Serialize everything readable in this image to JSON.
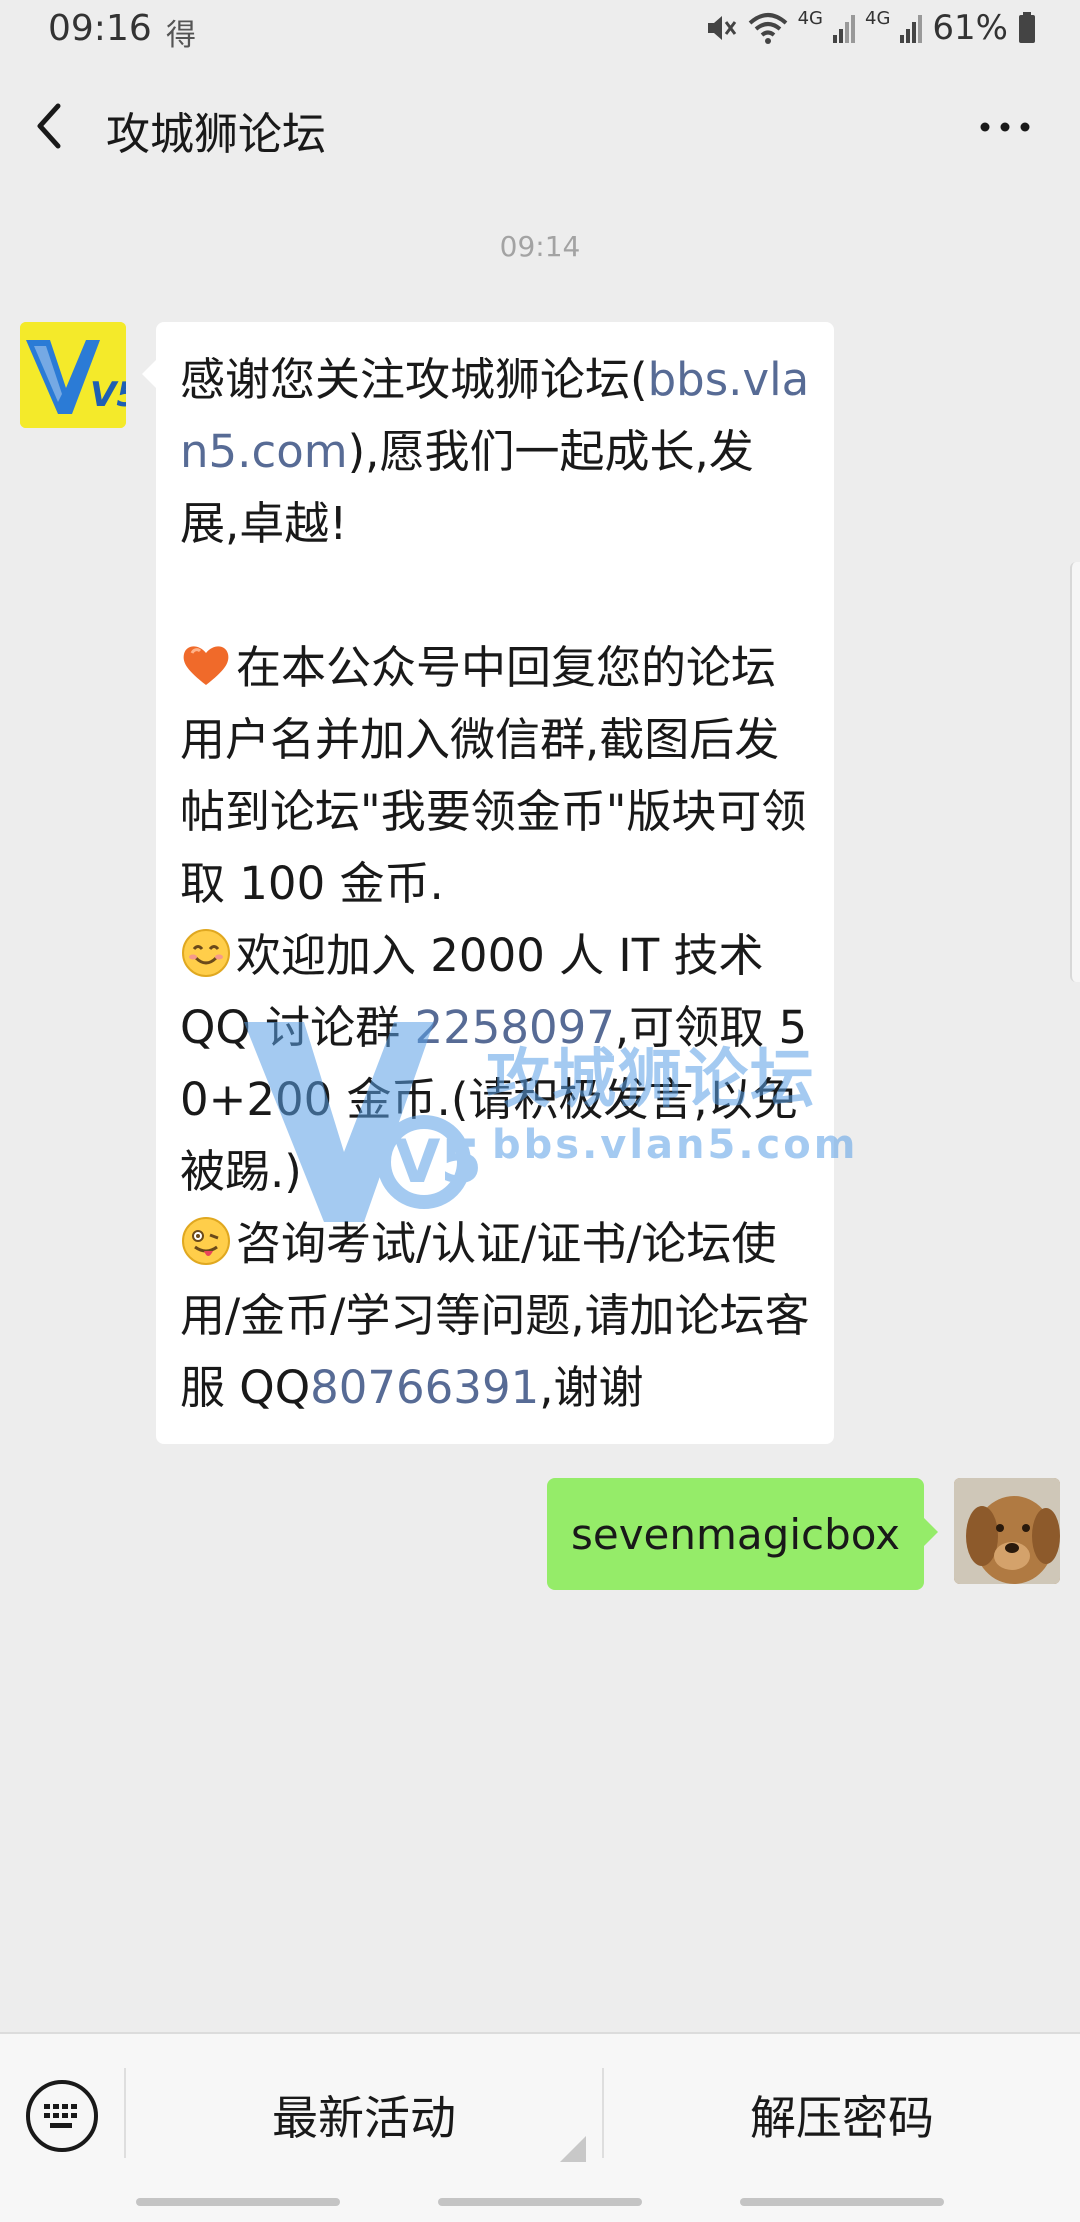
{
  "status_bar": {
    "time": "09:16",
    "app_icon": "得",
    "net1": "4G",
    "net2": "4G",
    "battery": "61%"
  },
  "header": {
    "title": "攻城狮论坛"
  },
  "chat": {
    "timestamp": "09:14",
    "left_avatar": {
      "text": "V5"
    },
    "received": {
      "p1_a": "感谢您关注攻城狮论坛(",
      "p1_link": "bbs.vlan5.com",
      "p1_b": "),愿我们一起成长,发展,卓越!",
      "p2": "在本公众号中回复您的论坛用户名并加入微信群,截图后发帖到论坛\"我要领金币\"版块可领取 100 金币.",
      "p3_a": "欢迎加入 2000 人 IT 技术 QQ 讨论群 ",
      "p3_link": "2258097",
      "p3_b": ",可领取 50+200 金币.(请积极发言,以免被踢.)",
      "p4_a": "咨询考试/认证/证书/论坛使用/金币/学习等问题,请加论坛客服 QQ",
      "p4_link": "80766391",
      "p4_b": ",谢谢"
    },
    "watermark": {
      "logo": "V5",
      "title": "攻城狮论坛",
      "url": "bbs.vlan5.com"
    },
    "sent": {
      "text": "sevenmagicbox"
    }
  },
  "bottom_menu": {
    "item1": "最新活动",
    "item2": "解压密码"
  },
  "colors": {
    "background": "#ededed",
    "sent_bubble": "#95ec69",
    "link": "#576b95",
    "avatar_yellow": "#f4ea2a"
  }
}
